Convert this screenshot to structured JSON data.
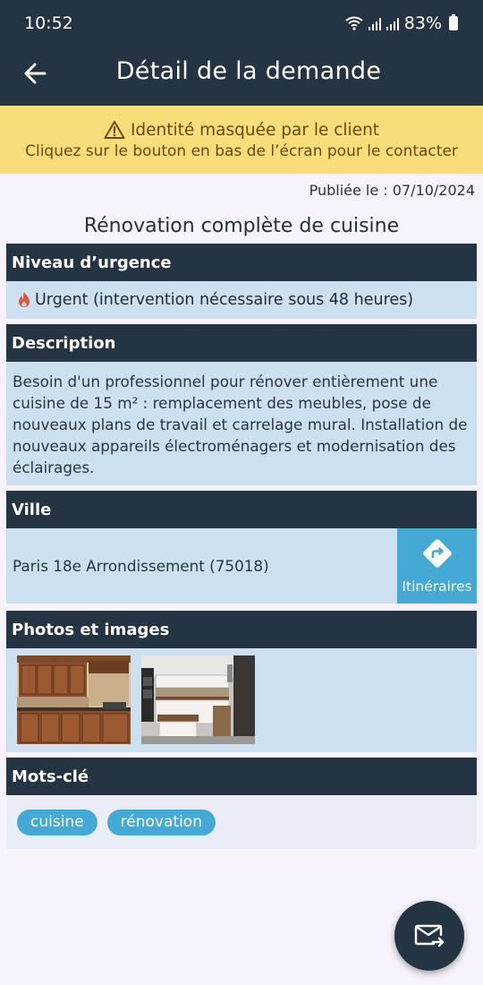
{
  "status_bar": {
    "time": "10:52",
    "battery": "83%"
  },
  "header": {
    "title": "Détail de la demande"
  },
  "warning": {
    "line1": "Identité masquée par le client",
    "line2": "Cliquez sur le bouton en bas de l’écran pour le contacter"
  },
  "published": "Publiée le : 07/10/2024",
  "request_title": "Rénovation complète de cuisine",
  "urgency": {
    "heading": "Niveau d’urgence",
    "value": "Urgent (intervention nécessaire sous 48 heures)"
  },
  "description": {
    "heading": "Description",
    "text": "Besoin d'un professionnel pour rénover entièrement une cuisine de 15 m² : remplacement des meubles, pose de nouveaux plans de travail et carrelage mural. Installation de nouveaux appareils électroménagers et modernisation des éclairages."
  },
  "city": {
    "heading": "Ville",
    "value": "Paris 18e Arrondissement  (75018)",
    "directions_label": "Itinéraires"
  },
  "photos": {
    "heading": "Photos et images"
  },
  "keywords": {
    "heading": "Mots-clé",
    "items": [
      "cuisine",
      "rénovation"
    ]
  },
  "colors": {
    "header_bg": "#243442",
    "accent": "#45a9d6",
    "warning_bg": "#f9dd7a",
    "section_bg": "#cde0f0"
  }
}
